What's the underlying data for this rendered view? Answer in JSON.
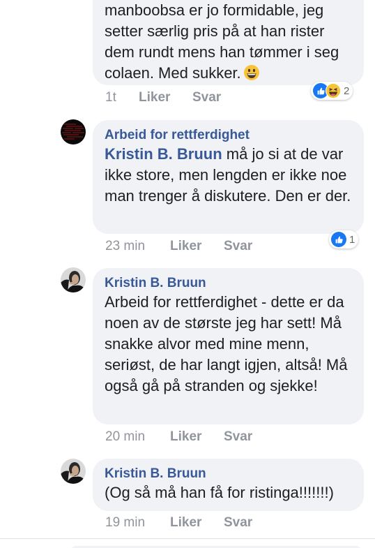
{
  "comment1": {
    "text": "manboobsa er jo formidable, jeg setter særlig pris på at han rister dem rundt mens han tømmer i seg colaen. Med sukker.",
    "time": "1t",
    "like_label": "Liker",
    "reply_label": "Svar",
    "reaction_count": "2",
    "reaction_icons": [
      "like-icon",
      "haha-icon"
    ]
  },
  "comment2": {
    "author": "Arbeid for rettferdighet",
    "mention": "Kristin B. Bruun",
    "text": " må jo si at de var ikke store, men lengden er ikke noe man trenger å diskutere. Den er der.",
    "time": "23 min",
    "like_label": "Liker",
    "reply_label": "Svar",
    "reaction_count": "1",
    "reaction_icons": [
      "like-icon"
    ]
  },
  "comment3": {
    "author": "Kristin B. Bruun",
    "text": "Arbeid for rettferdighet - dette er da noen av de største jeg har sett! Må snakke alvor med mine menn, seriøst, de har langt igjen, altså! Må også gå på stranden og sjekke!",
    "time": "20 min",
    "like_label": "Liker",
    "reply_label": "Svar"
  },
  "comment4": {
    "author": "Kristin B. Bruun",
    "text": "(Og så må han få for ristinga!!!!!!!)",
    "time": "19 min",
    "like_label": "Liker",
    "reply_label": "Svar"
  },
  "colors": {
    "bubble": "#f0f2f5",
    "author": "#385898",
    "meta": "#90949c",
    "like_reaction": "#1877f2",
    "haha_reaction": "#f7c338"
  }
}
